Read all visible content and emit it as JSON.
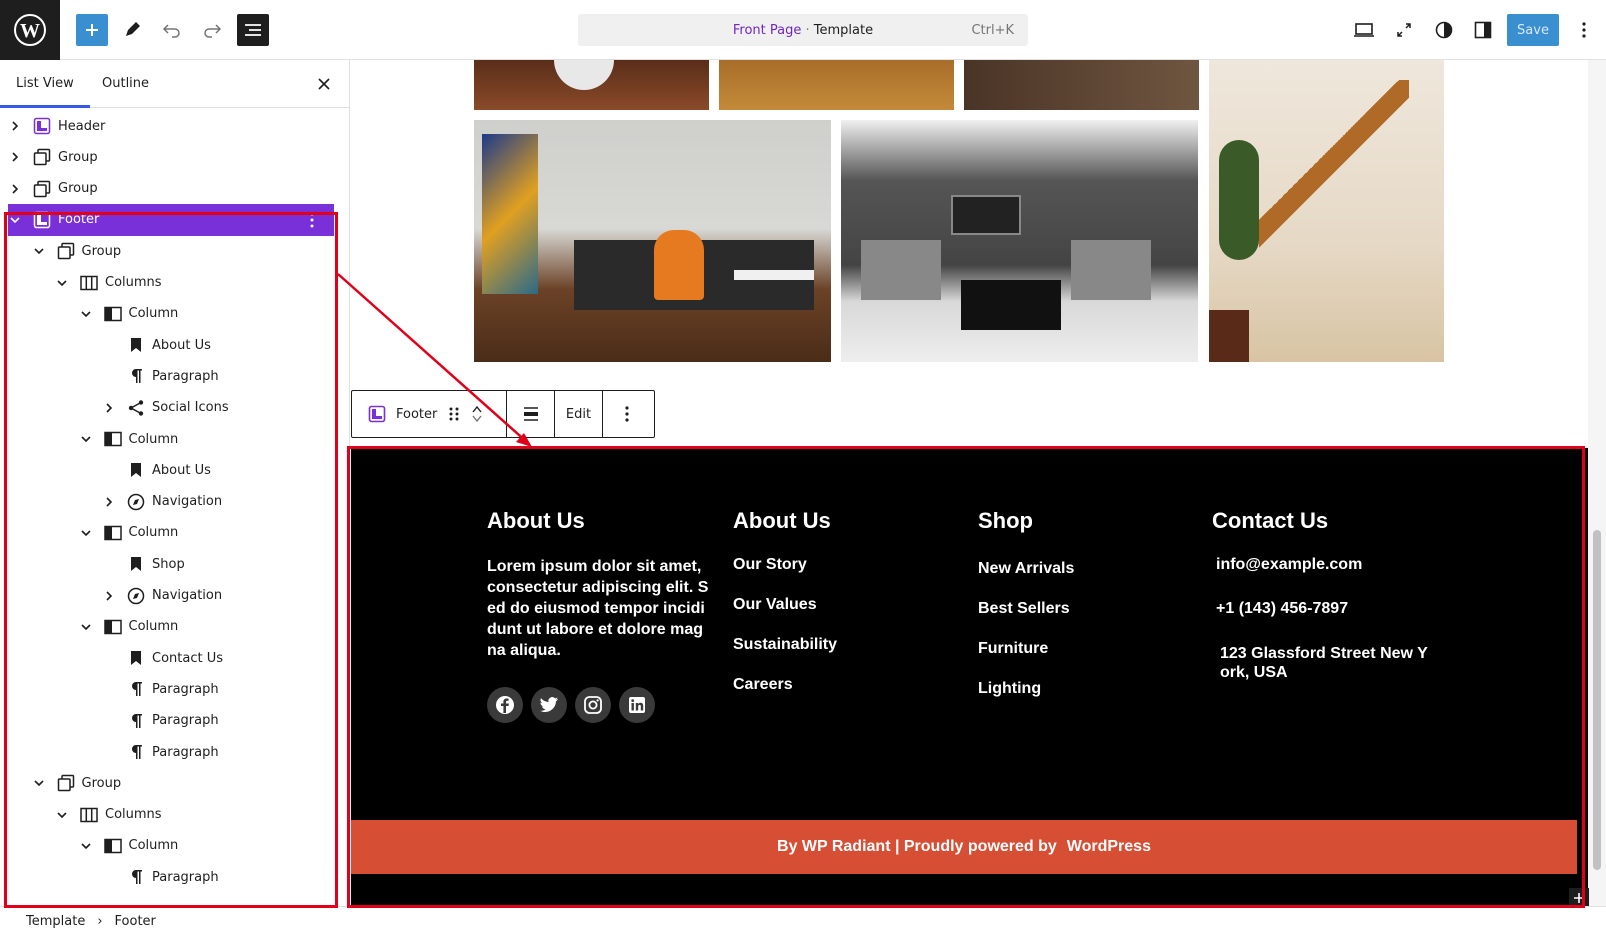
{
  "topbar": {
    "wp_logo": "wordpress-logo",
    "add_icon": "plus-icon",
    "tools_icon": "pencil-icon",
    "undo_icon": "undo-icon",
    "redo_icon": "redo-icon",
    "document_overview_icon": "list-view-icon",
    "doc_page": "Front Page",
    "doc_sep": " · ",
    "doc_type": "Template",
    "shortcut": "Ctrl+K",
    "view_icon": "desktop-icon",
    "fullscreen_icon": "expand-icon",
    "styles_icon": "contrast-icon",
    "settings_icon": "sidebar-icon",
    "save_label": "Save",
    "options_icon": "kebab-icon"
  },
  "sidebar": {
    "tabs": [
      {
        "label": "List View",
        "active": true
      },
      {
        "label": "Outline",
        "active": false
      }
    ],
    "close_icon": "close-icon",
    "tree": [
      {
        "label": "Header",
        "icon": "template-part-icon",
        "depth": 0,
        "chevron": "right"
      },
      {
        "label": "Group",
        "icon": "group-icon",
        "depth": 0,
        "chevron": "right"
      },
      {
        "label": "Group",
        "icon": "group-icon",
        "depth": 0,
        "chevron": "right"
      },
      {
        "label": "Footer",
        "icon": "template-part-icon",
        "depth": 0,
        "chevron": "down",
        "selected": true
      },
      {
        "label": "Group",
        "icon": "group-icon",
        "depth": 1,
        "chevron": "down"
      },
      {
        "label": "Columns",
        "icon": "columns-icon",
        "depth": 2,
        "chevron": "down"
      },
      {
        "label": "Column",
        "icon": "column-icon",
        "depth": 3,
        "chevron": "down"
      },
      {
        "label": "About Us",
        "icon": "heading-icon",
        "depth": 4,
        "chevron": ""
      },
      {
        "label": "Paragraph",
        "icon": "paragraph-icon",
        "depth": 4,
        "chevron": ""
      },
      {
        "label": "Social Icons",
        "icon": "share-icon",
        "depth": 4,
        "chevron": "right"
      },
      {
        "label": "Column",
        "icon": "column-icon",
        "depth": 3,
        "chevron": "down"
      },
      {
        "label": "About Us",
        "icon": "heading-icon",
        "depth": 4,
        "chevron": ""
      },
      {
        "label": "Navigation",
        "icon": "navigation-icon",
        "depth": 4,
        "chevron": "right"
      },
      {
        "label": "Column",
        "icon": "column-icon",
        "depth": 3,
        "chevron": "down"
      },
      {
        "label": "Shop",
        "icon": "heading-icon",
        "depth": 4,
        "chevron": ""
      },
      {
        "label": "Navigation",
        "icon": "navigation-icon",
        "depth": 4,
        "chevron": "right"
      },
      {
        "label": "Column",
        "icon": "column-icon",
        "depth": 3,
        "chevron": "down"
      },
      {
        "label": "Contact Us",
        "icon": "heading-icon",
        "depth": 4,
        "chevron": ""
      },
      {
        "label": "Paragraph",
        "icon": "paragraph-icon",
        "depth": 4,
        "chevron": ""
      },
      {
        "label": "Paragraph",
        "icon": "paragraph-icon",
        "depth": 4,
        "chevron": ""
      },
      {
        "label": "Paragraph",
        "icon": "paragraph-icon",
        "depth": 4,
        "chevron": ""
      },
      {
        "label": "Group",
        "icon": "group-icon",
        "depth": 1,
        "chevron": "down"
      },
      {
        "label": "Columns",
        "icon": "columns-icon",
        "depth": 2,
        "chevron": "down"
      },
      {
        "label": "Column",
        "icon": "column-icon",
        "depth": 3,
        "chevron": "down"
      },
      {
        "label": "Paragraph",
        "icon": "paragraph-icon",
        "depth": 4,
        "chevron": ""
      }
    ]
  },
  "breadcrumb": {
    "items": [
      "Template",
      "Footer"
    ]
  },
  "block_toolbar": {
    "block_label": "Footer",
    "block_icon": "template-part-icon",
    "drag_icon": "drag-handle-icon",
    "move_up_icon": "chevron-up-icon",
    "move_down_icon": "chevron-down-icon",
    "align_icon": "align-icon",
    "edit_label": "Edit",
    "more_icon": "kebab-icon"
  },
  "footer": {
    "col1": {
      "heading": "About Us",
      "text": "Lorem ipsum dolor sit amet, consectetur adipiscing elit. Sed do eiusmod tempor incididunt ut labore et dolore magna aliqua.",
      "social": [
        "facebook-icon",
        "twitter-icon",
        "instagram-icon",
        "linkedin-icon"
      ]
    },
    "col2": {
      "heading": "About Us",
      "links": [
        "Our Story",
        "Our Values",
        "Sustainability",
        "Careers"
      ]
    },
    "col3": {
      "heading": "Shop",
      "links": [
        "New Arrivals",
        "Best Sellers",
        "Furniture",
        "Lighting"
      ]
    },
    "col4": {
      "heading": "Contact Us",
      "lines": [
        "info@example.com",
        "+1 (143) 456-7897",
        "123 Glassford Street New York, USA"
      ]
    },
    "copyright": "By WP Radiant | Proudly powered by",
    "copyright_link": "WordPress",
    "bg_color": "#000000",
    "bar_color": "#d64e34"
  },
  "colors": {
    "accent": "#3858e9",
    "selected": "#7a30d8",
    "annotation": "#e0001a",
    "save": "#3a8fd1"
  }
}
